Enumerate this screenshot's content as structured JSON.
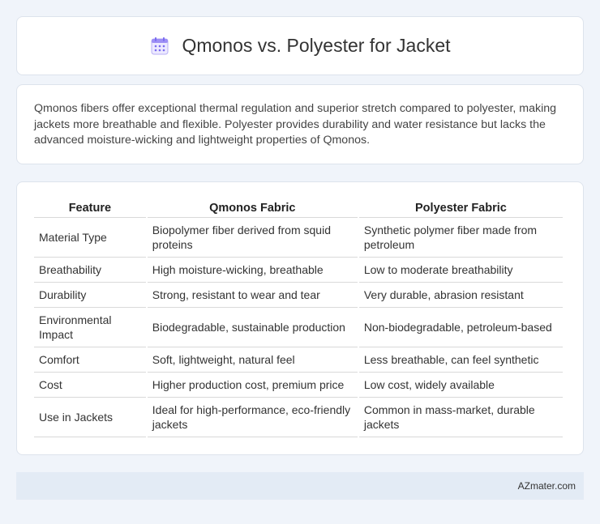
{
  "header": {
    "icon": "calendar-icon",
    "title": "Qmonos vs. Polyester for Jacket"
  },
  "intro": {
    "text": "Qmonos fibers offer exceptional thermal regulation and superior stretch compared to polyester, making jackets more breathable and flexible. Polyester provides durability and water resistance but lacks the advanced moisture-wicking and lightweight properties of Qmonos."
  },
  "table": {
    "columns": [
      "Feature",
      "Qmonos Fabric",
      "Polyester Fabric"
    ],
    "rows": [
      [
        "Material Type",
        "Biopolymer fiber derived from squid proteins",
        "Synthetic polymer fiber made from petroleum"
      ],
      [
        "Breathability",
        "High moisture-wicking, breathable",
        "Low to moderate breathability"
      ],
      [
        "Durability",
        "Strong, resistant to wear and tear",
        "Very durable, abrasion resistant"
      ],
      [
        "Environmental Impact",
        "Biodegradable, sustainable production",
        "Non-biodegradable, petroleum-based"
      ],
      [
        "Comfort",
        "Soft, lightweight, natural feel",
        "Less breathable, can feel synthetic"
      ],
      [
        "Cost",
        "Higher production cost, premium price",
        "Low cost, widely available"
      ],
      [
        "Use in Jackets",
        "Ideal for high-performance, eco-friendly jackets",
        "Common in mass-market, durable jackets"
      ]
    ]
  },
  "footer": {
    "text": "AZmater.com"
  },
  "colors": {
    "background": "#f0f4fa",
    "footer_bg": "#e3ebf5",
    "icon_accent": "#7b6cf0"
  }
}
